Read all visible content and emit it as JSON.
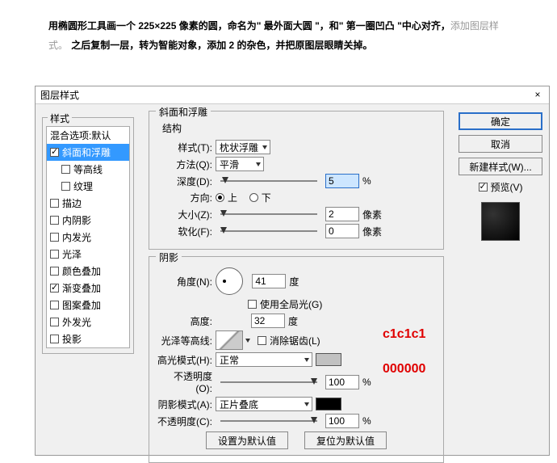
{
  "instruction": {
    "part1": "用椭圆形工具画一个 225×225 像素的圆，命名为\" 最外面大圆 \"，和\" 第一圈凹凸 \"中心对齐，",
    "gray": "添加图层样式。",
    "part2": "之后复制一层，转为智能对象，添加 2 的杂色，并把原图层眼睛关掉。"
  },
  "dialog": {
    "title": "图层样式",
    "close": "×",
    "styles_label": "样式",
    "blend_default": "混合选项:默认",
    "items": {
      "bevel": "斜面和浮雕",
      "contour": "等高线",
      "texture": "纹理",
      "stroke": "描边",
      "inner_shadow": "内阴影",
      "inner_glow": "内发光",
      "satin": "光泽",
      "color_overlay": "颜色叠加",
      "grad_overlay": "渐变叠加",
      "pattern_overlay": "图案叠加",
      "outer_glow": "外发光",
      "drop_shadow": "投影"
    },
    "bevel": {
      "group": "斜面和浮雕",
      "struct": "结构",
      "style_lbl": "样式(T):",
      "style_val": "枕状浮雕",
      "method_lbl": "方法(Q):",
      "method_val": "平滑",
      "depth_lbl": "深度(D):",
      "depth_val": "5",
      "pct": "%",
      "dir_lbl": "方向:",
      "up": "上",
      "down": "下",
      "size_lbl": "大小(Z):",
      "size_val": "2",
      "px": "像素",
      "soft_lbl": "软化(F):",
      "soft_val": "0"
    },
    "shade": {
      "group": "阴影",
      "angle_lbl": "角度(N):",
      "angle_val": "41",
      "deg": "度",
      "global": "使用全局光(G)",
      "alt_lbl": "高度:",
      "alt_val": "32",
      "gloss_lbl": "光泽等高线:",
      "antialias": "消除锯齿(L)",
      "hilite_lbl": "高光模式(H):",
      "hilite_val": "正常",
      "hilite_op_lbl": "不透明度(O):",
      "hilite_op_val": "100",
      "shadow_lbl": "阴影模式(A):",
      "shadow_val": "正片叠底",
      "shadow_op_lbl": "不透明度(C):",
      "shadow_op_val": "100",
      "default_btn": "设置为默认值",
      "reset_btn": "复位为默认值"
    },
    "right": {
      "ok": "确定",
      "cancel": "取消",
      "new_style": "新建样式(W)...",
      "preview": "预览(V)"
    },
    "annot": {
      "hilite_color": "c1c1c1",
      "shadow_color": "000000"
    },
    "pct": "%"
  }
}
